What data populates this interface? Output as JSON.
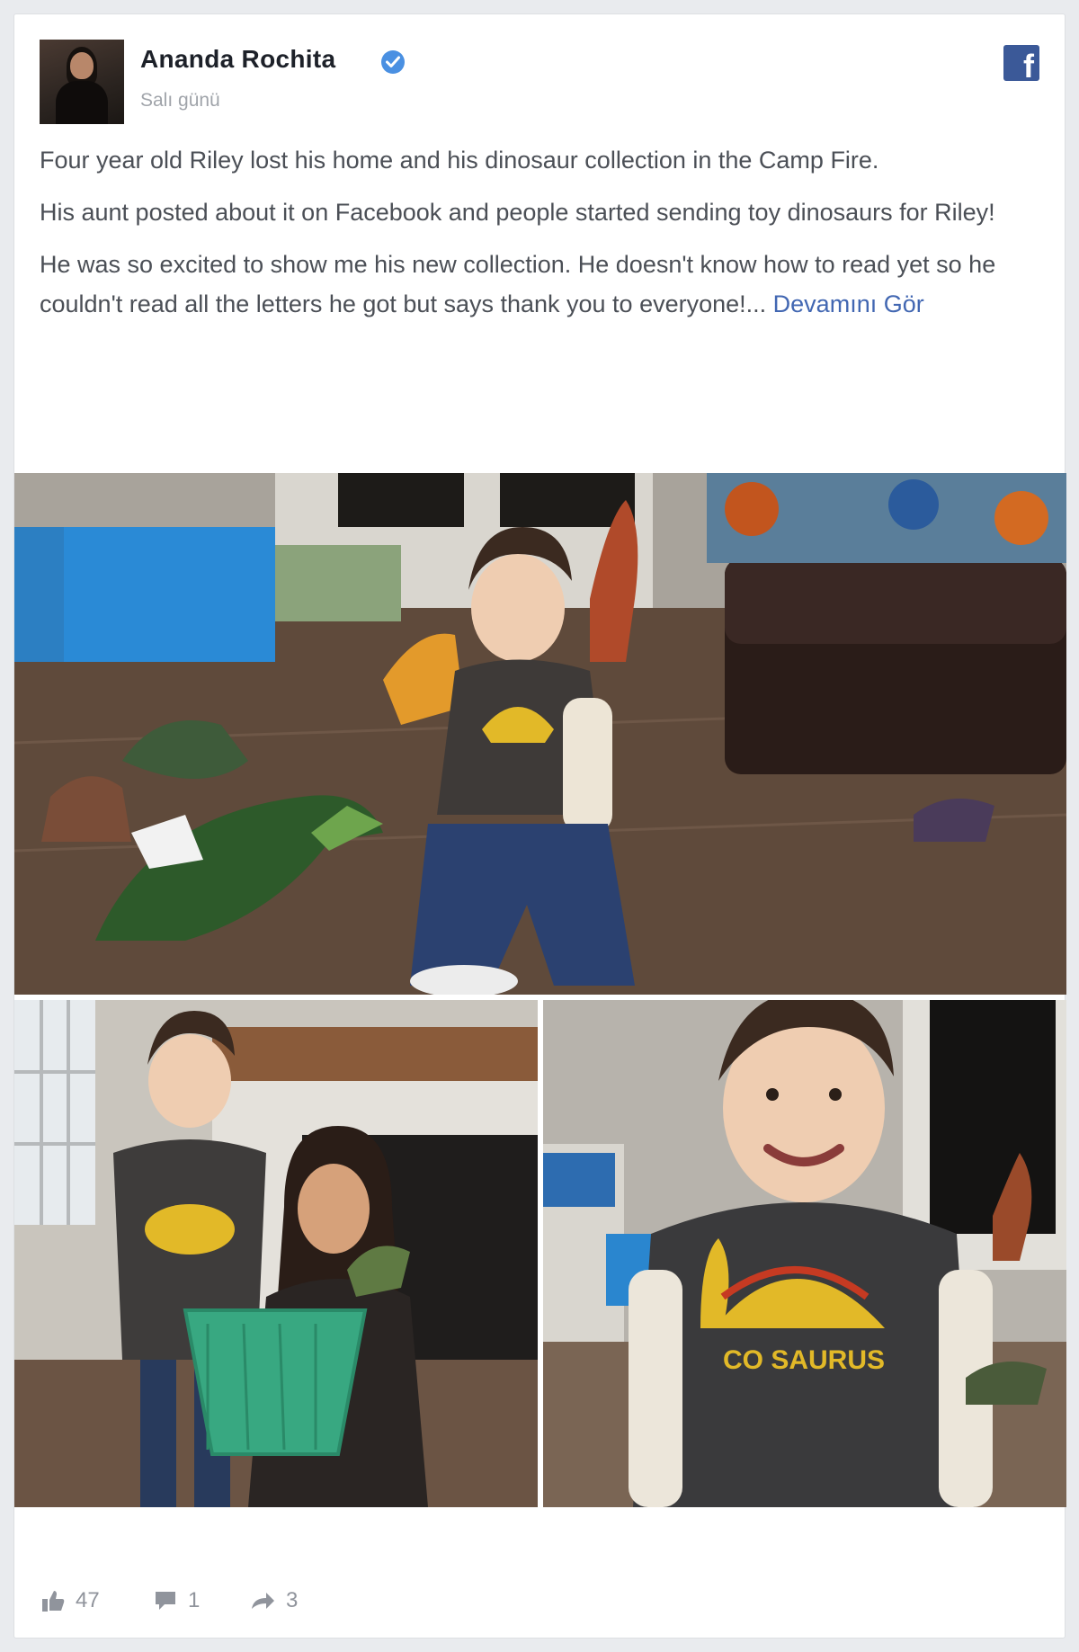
{
  "post": {
    "author_name": "Ananda Rochita",
    "timestamp": "Salı günü",
    "paragraphs": [
      "Four year old Riley lost his home and his dinosaur collection in the Camp Fire.",
      "His aunt posted about it on Facebook and people started sending toy dinosaurs for Riley!",
      "He was so excited to show me his new collection. He doesn't know how to read yet so he couldn't read all the letters he got but says thank you to everyone!..."
    ],
    "see_more": "Devamını Gör"
  },
  "icons": {
    "verified": "verified-badge-icon",
    "platform": "facebook-logo-icon",
    "like": "thumbs-up-icon",
    "comment": "comment-bubble-icon",
    "share": "share-arrow-icon"
  },
  "footer": {
    "likes": "47",
    "comments": "1",
    "shares": "3"
  },
  "colors": {
    "link": "#4267b2",
    "verified": "#4a90e2",
    "facebook": "#3b5998"
  }
}
